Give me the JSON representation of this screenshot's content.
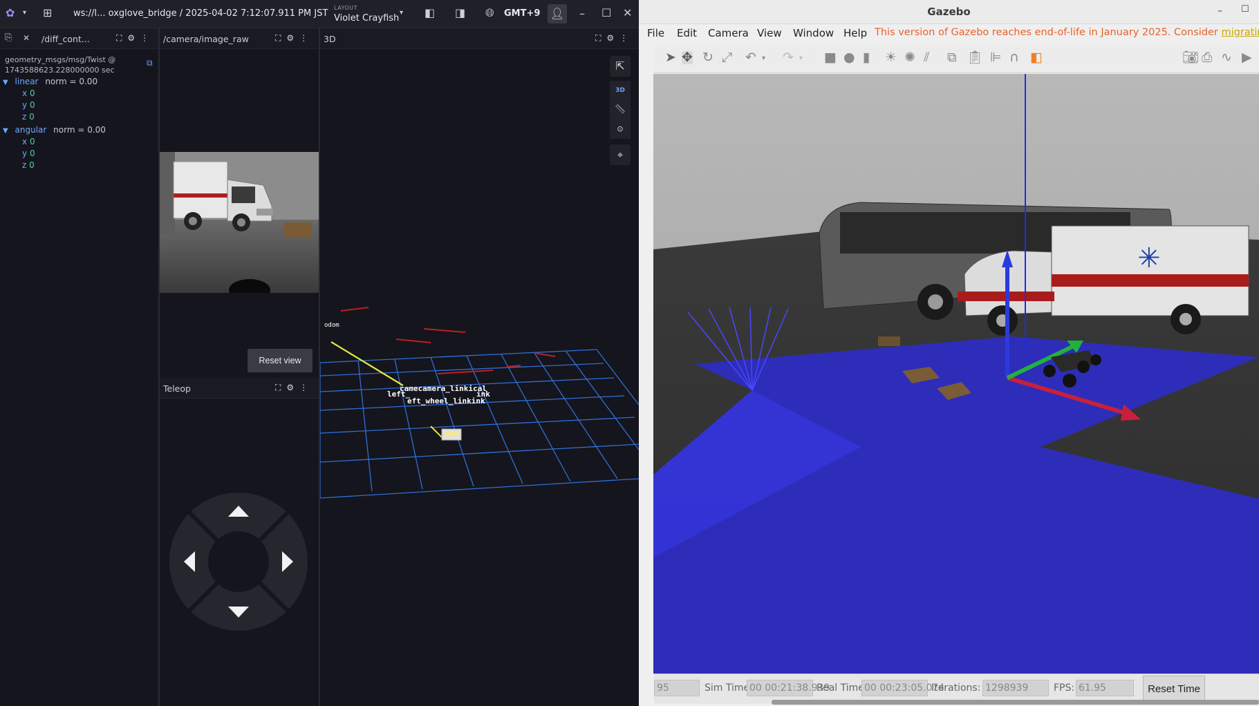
{
  "foxglove": {
    "title": "ws://l... oxglove_bridge / 2025-04-02 7:12:07.911 PM JST",
    "layout_caption": "LAYOUT",
    "layout_name": "Violet Crayfish",
    "timezone": "GMT+9"
  },
  "raw_panel": {
    "title": "/diff_cont...",
    "msg_type": "geometry_msgs/msg/Twist @",
    "stamp": "1743588623.228000000 sec",
    "linear": {
      "label": "linear",
      "norm": "norm = 0.00",
      "x": "0",
      "y": "0",
      "z": "0"
    },
    "angular": {
      "label": "angular",
      "norm": "norm = 0.00",
      "x": "0",
      "y": "0",
      "z": "0"
    },
    "axis_labels": {
      "x": "x",
      "y": "y",
      "z": "z"
    }
  },
  "image_panel": {
    "title": "/camera/image_raw",
    "reset_label": "Reset view"
  },
  "teleop_panel": {
    "title": "Teleop"
  },
  "panel_3d": {
    "title": "3D",
    "mode_label": "3D",
    "frames": {
      "odom": "odom",
      "overlap1": "camecamera_linkical",
      "overlap2": "left_",
      "overlap3": "ink",
      "overlap4": "eft_wheel_linkink"
    }
  },
  "gazebo": {
    "title": "Gazebo",
    "menus": [
      "File",
      "Edit",
      "Camera",
      "View",
      "Window",
      "Help"
    ],
    "notice": "This version of Gazebo reaches end-of-life in January 2025. Consider ",
    "notice_link": "migrating to t",
    "status": {
      "partial": "95",
      "sim_time_label": "Sim Time:",
      "sim_time": "00 00:21:38.939",
      "real_time_label": "Real Time:",
      "real_time": "00 00:23:05.074",
      "iterations_label": "Iterations:",
      "iterations": "1298939",
      "fps_label": "FPS:",
      "fps": "61.95",
      "reset_label": "Reset Time"
    }
  },
  "colors": {
    "accent": "#8b5cf6",
    "grid": "#2f6fd6",
    "laser": "#2020e8",
    "warning": "#e8622c"
  }
}
